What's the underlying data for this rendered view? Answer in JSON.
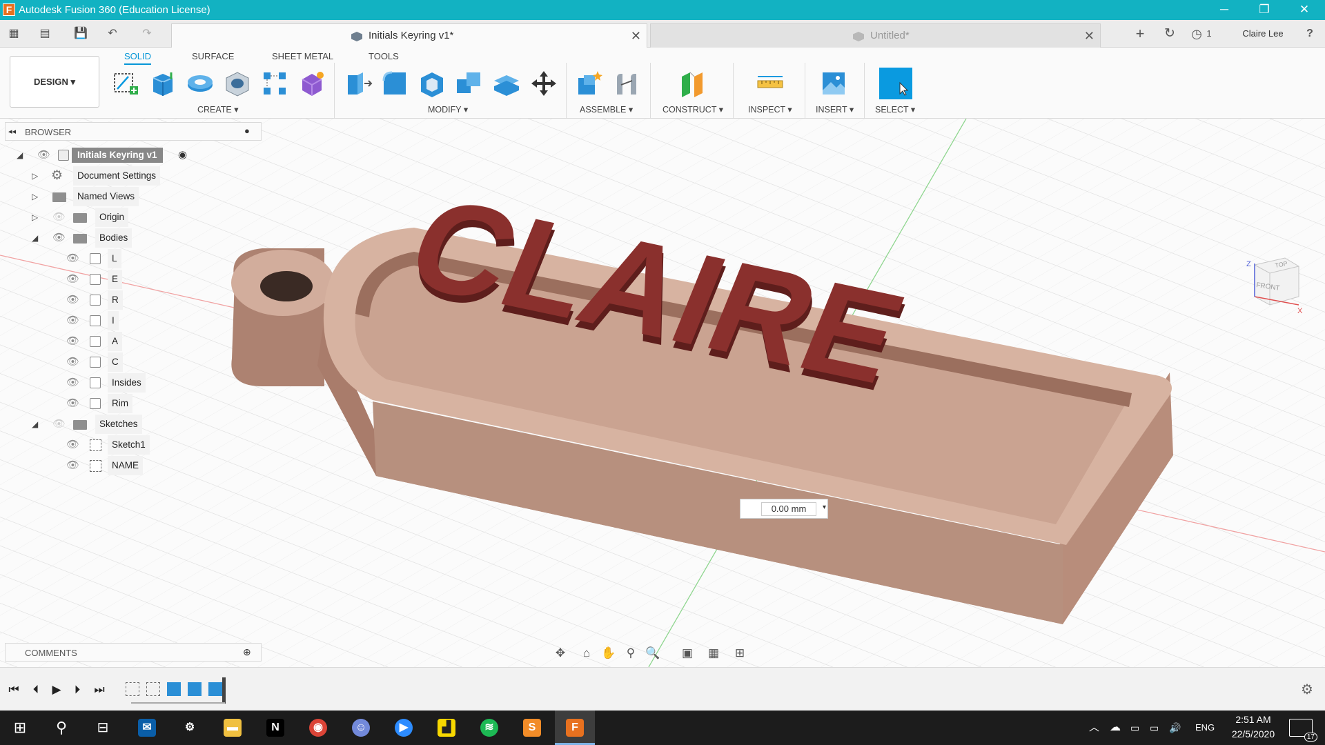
{
  "titlebar": {
    "title": "Autodesk Fusion 360 (Education License)",
    "app_icon_letter": "F",
    "minimize": "─",
    "restore": "❐",
    "close": "✕"
  },
  "qat": {
    "grid_icon": "▦",
    "file_icon": "▤",
    "save_icon": "💾",
    "undo_icon": "↶",
    "redo_icon": "↷",
    "new_tab_icon": "+",
    "job_status_icon": "↻",
    "notifications_icon": "◷",
    "notifications_count": "1",
    "user_name": "Claire Lee",
    "help_icon": "?"
  },
  "tabs": [
    {
      "title": "Initials Keyring v1*",
      "close": "✕",
      "active": true
    },
    {
      "title": "Untitled*",
      "close": "✕",
      "active": false
    }
  ],
  "ribbon": {
    "workspace": "DESIGN ▾",
    "tabs": [
      "SOLID",
      "SURFACE",
      "SHEET METAL",
      "TOOLS"
    ],
    "groups": {
      "create": "CREATE ▾",
      "modify": "MODIFY ▾",
      "assemble": "ASSEMBLE ▾",
      "construct": "CONSTRUCT ▾",
      "inspect": "INSPECT ▾",
      "insert": "INSERT ▾",
      "select": "SELECT ▾"
    }
  },
  "browser": {
    "header": "BROWSER",
    "collapse_icon": "◂◂",
    "pin_icon": "●",
    "root": "Initials Keyring v1",
    "items": [
      {
        "label": "Document Settings",
        "arrow": "▷"
      },
      {
        "label": "Named Views",
        "arrow": "▷"
      },
      {
        "label": "Origin",
        "arrow": "▷"
      },
      {
        "label": "Bodies",
        "arrow": "◢"
      }
    ],
    "bodies": [
      "L",
      "E",
      "R",
      "I",
      "A",
      "C",
      "Insides",
      "Rim"
    ],
    "sketches_label": "Sketches",
    "sketches_arrow": "◢",
    "sketches": [
      "Sketch1",
      "NAME"
    ],
    "eye_icon": "👁"
  },
  "viewport": {
    "model_text": "CLAIRE",
    "dimension_value": "0.00 mm",
    "dimension_arrow": "▾",
    "viewcube": {
      "top": "TOP",
      "front": "FRONT",
      "axis_x": "X",
      "axis_z": "Z"
    }
  },
  "comments": {
    "header": "COMMENTS",
    "add_icon": "⊕"
  },
  "navbar": {
    "orbit": "✥",
    "look": "⌂",
    "pan": "✋",
    "zoom": "⚲",
    "fit": "🔍",
    "display": "▣",
    "grid": "▦",
    "viewports": "⊞"
  },
  "timeline": {
    "first": "⏮",
    "prev": "⏴",
    "play": "▶",
    "next": "⏵",
    "last": "⏭",
    "settings": "⚙"
  },
  "taskbar": {
    "start": "⊞",
    "search": "⚲",
    "taskview": "⊟",
    "apps": [
      {
        "name": "Mail",
        "glyph": "✉",
        "color": "#0a5ea8"
      },
      {
        "name": "Settings",
        "glyph": "⚙",
        "color": "#1c1c1c"
      },
      {
        "name": "File Explorer",
        "glyph": "▬",
        "color": "#f0c040"
      },
      {
        "name": "Netflix",
        "glyph": "N",
        "color": "#000000"
      },
      {
        "name": "Chrome",
        "glyph": "◉",
        "color": "#db4437"
      },
      {
        "name": "Discord",
        "glyph": "☺",
        "color": "#7289da"
      },
      {
        "name": "Zoom",
        "glyph": "▶",
        "color": "#2d8cff"
      },
      {
        "name": "Sticky Notes",
        "glyph": "▟",
        "color": "#f7d800"
      },
      {
        "name": "Spotify",
        "glyph": "≋",
        "color": "#1db954"
      },
      {
        "name": "Sublime Text",
        "glyph": "S",
        "color": "#f28c28"
      },
      {
        "name": "Fusion 360",
        "glyph": "F",
        "color": "#e8711f"
      }
    ],
    "tray_chevron": "︿",
    "tray_cloud": "☁",
    "tray_battery": "▭",
    "tray_network": "▭",
    "tray_volume": "🔊",
    "language": "ENG",
    "time": "2:51 AM",
    "date": "22/5/2020",
    "notifications": "17"
  },
  "colors": {
    "titlebar": "#12b2c2",
    "accent": "#0696d7",
    "model_body": "#c69f8e",
    "letters": "#7a2a28",
    "select_tool": "#0a9ae0"
  }
}
